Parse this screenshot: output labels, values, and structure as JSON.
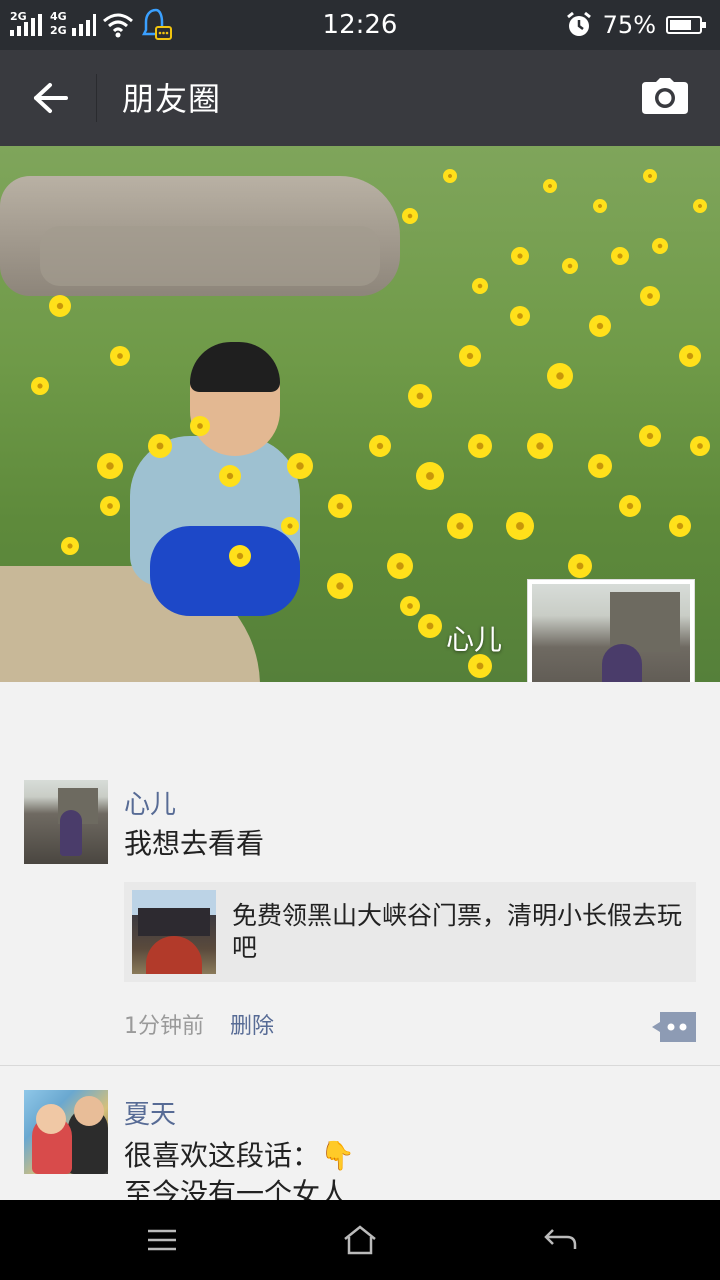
{
  "status_bar": {
    "network_top": "2G",
    "network_mid_a": "4G",
    "network_mid_b": "2G",
    "time": "12:26",
    "battery_percent": "75%",
    "battery_level": 0.75,
    "icons": [
      "signal-icon",
      "signal-icon",
      "wifi-icon",
      "chat-notification-icon",
      "alarm-icon",
      "battery-icon"
    ]
  },
  "header": {
    "title": "朋友圈",
    "back_icon": "arrow-left-icon",
    "camera_icon": "camera-icon"
  },
  "cover": {
    "username": "心儿"
  },
  "posts": [
    {
      "name": "心儿",
      "text": "我想去看看",
      "share_text": "免费领黑山大峡谷门票，清明小长假去玩吧",
      "time": "1分钟前",
      "delete_label": "删除"
    },
    {
      "name": "夏天",
      "text_line1": "很喜欢这段话：👇",
      "text_line2": "至今没有一个女人"
    }
  ],
  "bottom_nav": {
    "icons": [
      "menu-icon",
      "home-icon",
      "back-icon"
    ]
  },
  "colors": {
    "header_bg": "#393a3f",
    "status_bg": "#2a2d32",
    "link": "#576b95",
    "feed_bg": "#f2f2f2"
  }
}
